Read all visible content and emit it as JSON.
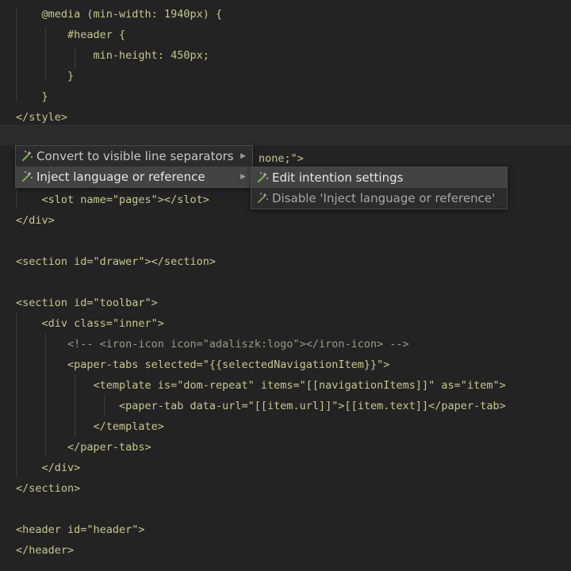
{
  "code_lines": [
    "    @media (min-width: 1940px) {",
    "        #header {",
    "            min-height: 450px;",
    "        }",
    "    }",
    "</style>",
    "",
    "",
    "",
    "    <slot name=\"pages\"></slot>",
    "</div>",
    "",
    "<section id=\"drawer\"></section>",
    "",
    "<section id=\"toolbar\">",
    "    <div class=\"inner\">",
    "        <!-- <iron-icon icon=\"adaliszk:logo\"></iron-icon> -->",
    "        <paper-tabs selected=\"{{selectedNavigationItem}}\">",
    "            <template is=\"dom-repeat\" items=\"[[navigationItems]]\" as=\"item\">",
    "                <paper-tab data-url=\"[[item.url]]\">[[item.text]]</paper-tab>",
    "            </template>",
    "        </paper-tabs>",
    "    </div>",
    "</section>",
    "",
    "<header id=\"header\">",
    "</header>"
  ],
  "partial_line_text": "none;\">",
  "intention_menu": {
    "items": [
      {
        "label": "Convert to visible line separators",
        "icon": "magic-wand-icon"
      },
      {
        "label": "Inject language or reference",
        "icon": "magic-wand-icon"
      }
    ]
  },
  "submenu": {
    "items": [
      {
        "label": "Edit intention settings",
        "icon": "magic-wand-icon"
      },
      {
        "label": "Disable 'Inject language or reference'",
        "icon": "magic-wand-icon"
      }
    ]
  }
}
